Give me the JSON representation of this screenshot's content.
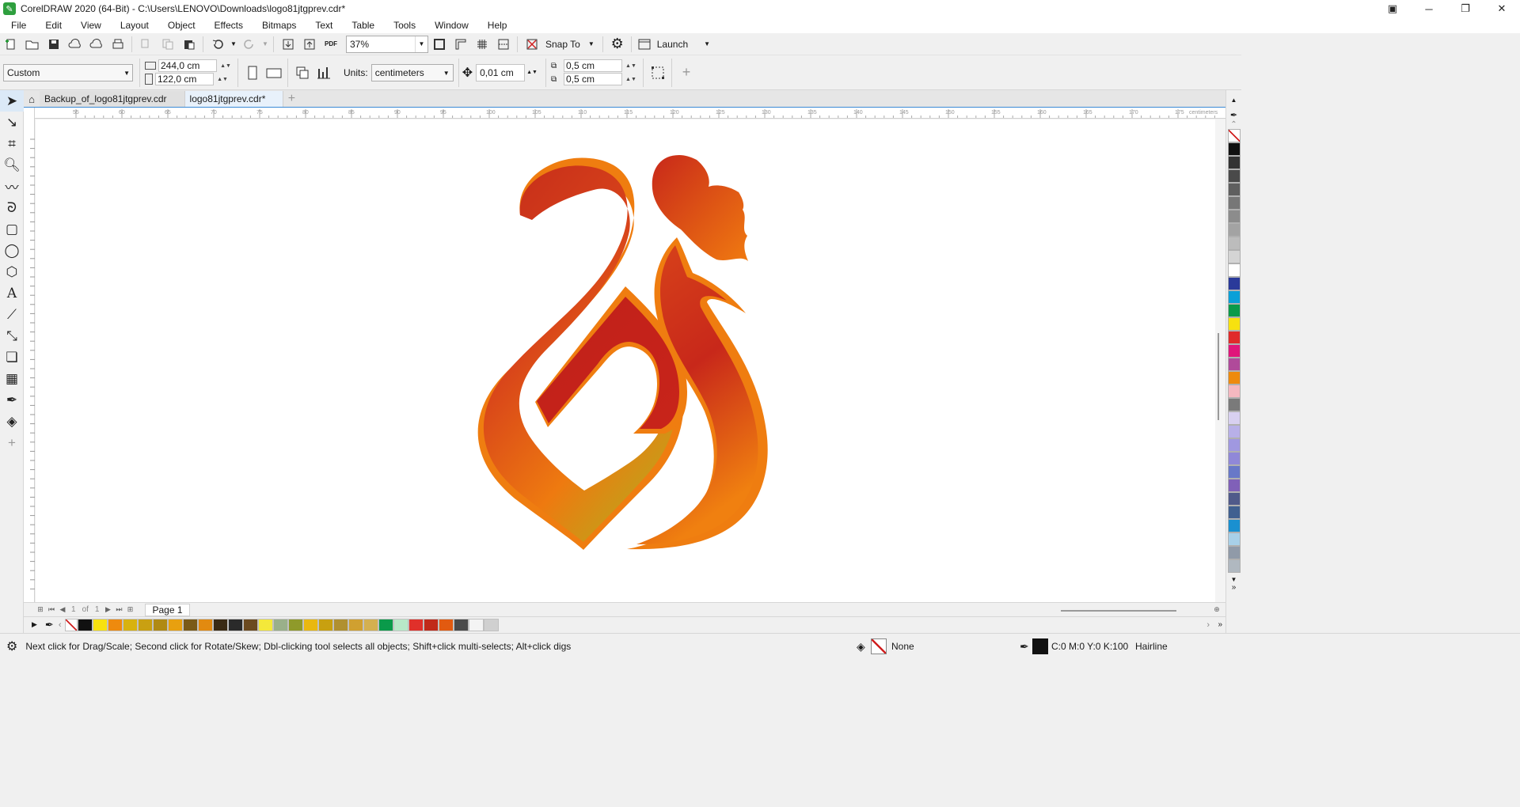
{
  "window": {
    "title": "CorelDRAW 2020 (64-Bit) - C:\\Users\\LENOVO\\Downloads\\logo81jtgprev.cdr*",
    "controls": [
      "restore-window-icon",
      "minimize-icon",
      "maximize-icon",
      "close-icon"
    ]
  },
  "menu": [
    "File",
    "Edit",
    "View",
    "Layout",
    "Object",
    "Effects",
    "Bitmaps",
    "Text",
    "Table",
    "Tools",
    "Window",
    "Help"
  ],
  "toolbar": {
    "zoom": "37%",
    "snap_to": "Snap To",
    "launch": "Launch",
    "pdf_label": "PDF"
  },
  "property_bar": {
    "preset": "Custom",
    "width": "244,0 cm",
    "height": "122,0 cm",
    "units_label": "Units:",
    "units": "centimeters",
    "nudge": "0,01 cm",
    "dup_x": "0,5 cm",
    "dup_y": "0,5 cm"
  },
  "tabs": [
    {
      "label": "Backup_of_logo81jtgprev.cdr",
      "active": false
    },
    {
      "label": "logo81jtgprev.cdr*",
      "active": true
    }
  ],
  "ruler": {
    "top_ticks": [
      "55",
      "60",
      "65",
      "70",
      "75",
      "80",
      "85",
      "90",
      "95",
      "100",
      "105",
      "110",
      "115",
      "120",
      "125",
      "130",
      "135",
      "140",
      "145",
      "150",
      "155",
      "160",
      "165",
      "170",
      "175"
    ],
    "unit": "centimeters"
  },
  "page_nav": {
    "current": "1",
    "of_label": "of",
    "total": "1",
    "page_tab": "Page 1"
  },
  "status": {
    "hint": "Next click for Drag/Scale; Second click for Rotate/Skew; Dbl-clicking tool selects all objects; Shift+click multi-selects; Alt+click digs",
    "fill": "None",
    "outline_color": "C:0 M:0 Y:0 K:100",
    "outline_width": "Hairline"
  },
  "bottom_palette": [
    "#111111",
    "#f7e10f",
    "#ee8a0e",
    "#d8b20f",
    "#c9a012",
    "#b08a14",
    "#e8a00f",
    "#7a5a18",
    "#e28a10",
    "#3a2a14",
    "#2a2a2a",
    "#6b4a20",
    "#f4e83a",
    "#9ab08a",
    "#8f9a2a",
    "#e9b810",
    "#c8a010",
    "#b09030",
    "#d0a030",
    "#d4b050",
    "#0a9a4a",
    "#b8e8c8",
    "#e0302a",
    "#c02a1a",
    "#e25a10",
    "#4a4a4a",
    "#f4f4f4",
    "#d0d0d0"
  ],
  "right_palette": [
    "#111111",
    "#333333",
    "#4a4a4a",
    "#5f5f5f",
    "#777777",
    "#8c8c8c",
    "#a3a3a3",
    "#bcbcbc",
    "#d4d4d4",
    "#ffffff",
    "#2a3a9a",
    "#0aa0d8",
    "#0a9a4a",
    "#f7e10f",
    "#e02a2a",
    "#e0157a",
    "#b04a9a",
    "#ee8a0e",
    "#f5b8c0",
    "#7a7a7a",
    "#d8d0f0",
    "#b8b0e8",
    "#a098e0",
    "#9088d8",
    "#6878c8",
    "#8060b8",
    "#505a8a",
    "#406090",
    "#1a90d0",
    "#a8d0e8",
    "#909aa8",
    "#b0b8c0"
  ],
  "logo_colors": {
    "dark": "#c0201a",
    "mid": "#d8441a",
    "light": "#f07a10",
    "gold": "#c99a18"
  }
}
